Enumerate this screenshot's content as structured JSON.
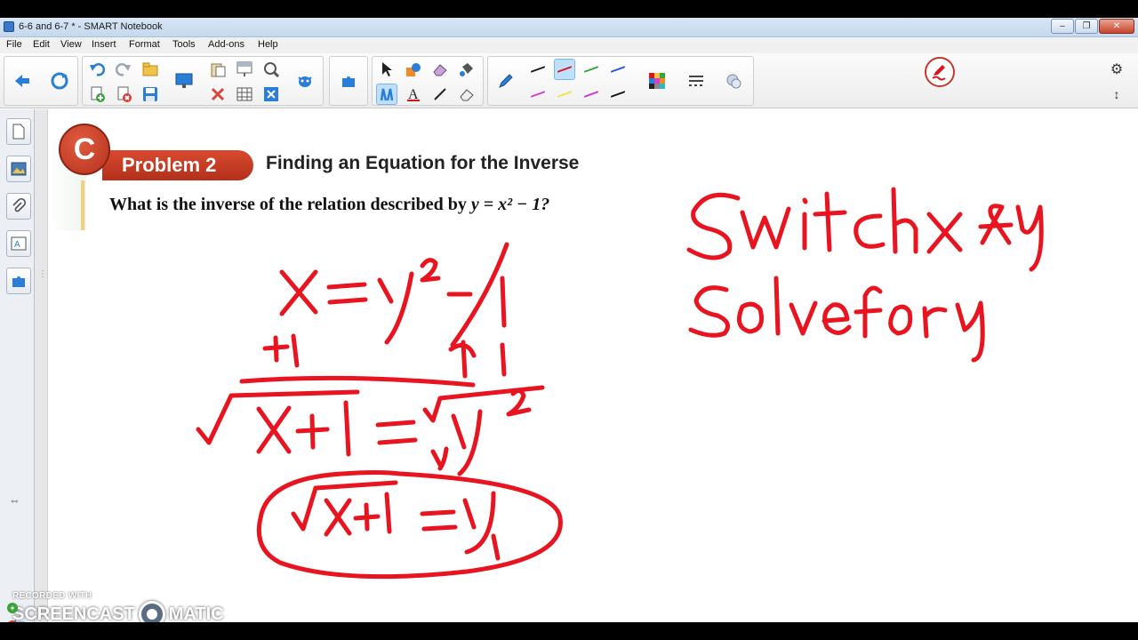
{
  "window": {
    "title": "6-6 and 6-7 * - SMART Notebook",
    "controls": [
      "–",
      "❐",
      "✕"
    ]
  },
  "menu": {
    "items": [
      "File",
      "Edit",
      "View",
      "Insert",
      "Format",
      "Tools",
      "Add-ons",
      "Help"
    ]
  },
  "toolbar": {
    "icons": [
      "back-arrow-icon",
      "forward-circle-icon",
      "undo-icon",
      "redo-icon",
      "open-file-icon",
      "add-page-icon",
      "delete-page-icon",
      "save-icon",
      "screen-icon",
      "paste-icon",
      "delete-icon",
      "screen-shade-icon",
      "magic-icon",
      "table-icon",
      "fullscreen-icon",
      "creature-icon",
      "addons-puzzle-icon",
      "select-arrow-icon",
      "shapes-icon",
      "eraser-icon",
      "fill-icon",
      "pen-icon",
      "text-icon",
      "line-icon",
      "eraser2-icon",
      "color-palette-icon",
      "line-style-icon",
      "properties-icon"
    ],
    "pen_colors": [
      "#1a1a1a",
      "#d8141c",
      "#2faa3a",
      "#2255d8",
      "#d040c8",
      "#f1e24a",
      "#d82fd0",
      "#111111"
    ],
    "selected_pen_color": "#d8141c"
  },
  "sidebar": {
    "tabs": [
      "page-sorter-icon",
      "gallery-icon",
      "attachments-icon",
      "properties-icon",
      "addons-icon"
    ]
  },
  "slide": {
    "problem_label": "Problem 2",
    "problem_title": "Finding an Equation for the Inverse",
    "question_prefix": "What is the inverse of the relation described by ",
    "question_equation": "y = x² − 1?",
    "logo_letter": "C"
  },
  "ink_color": "#e8141f",
  "watermark": {
    "recorded": "RECORDED WITH",
    "brand_left": "SCREENCAST",
    "brand_right": "MATIC"
  }
}
